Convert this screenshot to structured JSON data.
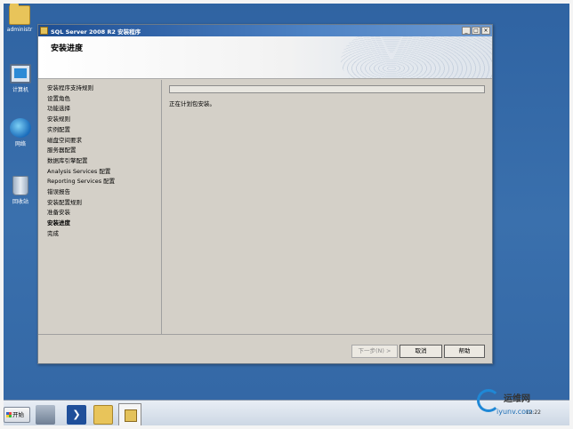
{
  "desktop": {
    "icons": [
      {
        "label": "administr",
        "icon": "folder-icon"
      },
      {
        "label": "计算机",
        "icon": "computer-icon"
      },
      {
        "label": "网络",
        "icon": "network-icon"
      },
      {
        "label": "回收站",
        "icon": "recycle-bin-icon"
      }
    ]
  },
  "window": {
    "title": "SQL Server 2008 R2 安装程序",
    "controls": {
      "minimize": "_",
      "maximize": "□",
      "close": "×"
    },
    "page_title": "安装进度",
    "nav": [
      {
        "label": "安装程序支持规则",
        "active": false
      },
      {
        "label": "设置角色",
        "active": false
      },
      {
        "label": "功能选择",
        "active": false
      },
      {
        "label": "安装规则",
        "active": false
      },
      {
        "label": "实例配置",
        "active": false
      },
      {
        "label": "磁盘空间要求",
        "active": false
      },
      {
        "label": "服务器配置",
        "active": false
      },
      {
        "label": "数据库引擎配置",
        "active": false
      },
      {
        "label": "Analysis Services 配置",
        "active": false
      },
      {
        "label": "Reporting Services 配置",
        "active": false
      },
      {
        "label": "错误报告",
        "active": false
      },
      {
        "label": "安装配置规则",
        "active": false
      },
      {
        "label": "准备安装",
        "active": false
      },
      {
        "label": "安装进度",
        "active": true
      },
      {
        "label": "完成",
        "active": false
      }
    ],
    "progress": 0,
    "status_text": "正在计划包安装。",
    "buttons": {
      "next": "下一步(N) >",
      "cancel": "取消",
      "help": "帮助"
    }
  },
  "taskbar": {
    "start_label": "开始",
    "clock": "12:22"
  },
  "watermark": {
    "name": "运维网",
    "url": "iyunv.com"
  }
}
